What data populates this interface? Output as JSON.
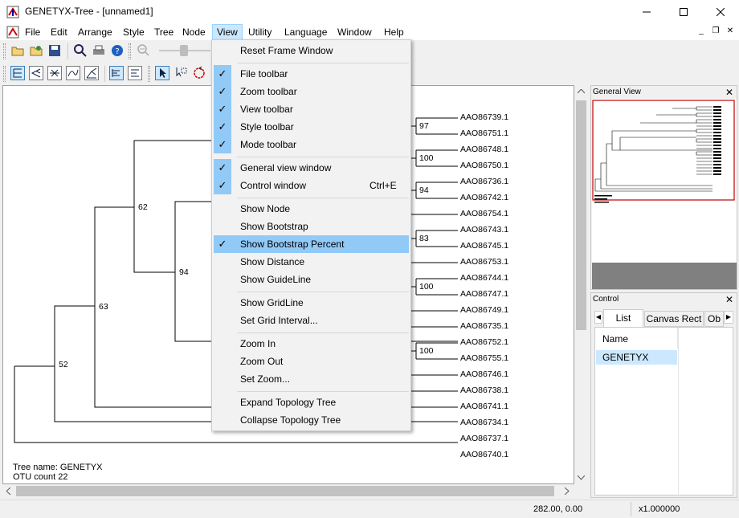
{
  "window": {
    "title": "GENETYX-Tree - [unnamed1]"
  },
  "menubar": {
    "items": [
      "File",
      "Edit",
      "Arrange",
      "Style",
      "Tree",
      "Node",
      "View",
      "Utility",
      "Language",
      "Window",
      "Help"
    ]
  },
  "view_menu": {
    "items": [
      {
        "label": "Reset Frame Window",
        "checked": false
      },
      {
        "label": "File toolbar",
        "checked": true
      },
      {
        "label": "Zoom toolbar",
        "checked": true
      },
      {
        "label": "View toolbar",
        "checked": true
      },
      {
        "label": "Style toolbar",
        "checked": true
      },
      {
        "label": "Mode toolbar",
        "checked": true
      },
      {
        "label": "General view window",
        "checked": true
      },
      {
        "label": "Control window",
        "checked": true,
        "shortcut": "Ctrl+E"
      },
      {
        "label": "Show Node",
        "checked": false
      },
      {
        "label": "Show Bootstrap",
        "checked": false
      },
      {
        "label": "Show Bootstrap Percent",
        "checked": true,
        "highlighted": true
      },
      {
        "label": "Show Distance",
        "checked": false
      },
      {
        "label": "Show GuideLine",
        "checked": false
      },
      {
        "label": "Show GridLine",
        "checked": false
      },
      {
        "label": "Set Grid Interval...",
        "checked": false
      },
      {
        "label": "Zoom In",
        "checked": false
      },
      {
        "label": "Zoom Out",
        "checked": false
      },
      {
        "label": "Set Zoom...",
        "checked": false
      },
      {
        "label": "Expand Topology Tree",
        "checked": false
      },
      {
        "label": "Collapse Topology Tree",
        "checked": false
      }
    ]
  },
  "tree": {
    "leaves": [
      "AAO86739.1",
      "AAO86751.1",
      "AAO86748.1",
      "AAO86750.1",
      "AAO86736.1",
      "AAO86742.1",
      "AAO86754.1",
      "AAO86743.1",
      "AAO86745.1",
      "AAO86753.1",
      "AAO86744.1",
      "AAO86747.1",
      "AAO86749.1",
      "AAO86735.1",
      "AAO86752.1",
      "AAO86755.1",
      "AAO86746.1",
      "AAO86738.1",
      "AAO86741.1",
      "AAO86734.1",
      "AAO86737.1",
      "AAO86740.1"
    ],
    "bootstrap": {
      "b97": "97",
      "b100a": "100",
      "b94a": "94",
      "b83": "83",
      "b100b": "100",
      "b100c": "100",
      "b62": "62",
      "b94b": "94",
      "b63": "63",
      "b52": "52"
    },
    "info": {
      "tree_name": "Tree name: GENETYX",
      "otu_count": "OTU count 22"
    }
  },
  "general_view": {
    "title": "General View"
  },
  "control": {
    "title": "Control",
    "tabs": [
      "List",
      "Canvas Rect",
      "Ob"
    ],
    "column_header": "Name",
    "row": "GENETYX"
  },
  "status": {
    "coords": "282.00, 0.00",
    "zoom": "x1.000000"
  },
  "colors": {
    "menu_highlight": "#91c9f7",
    "selection": "#cce8ff",
    "overview_border": "#c00000"
  }
}
